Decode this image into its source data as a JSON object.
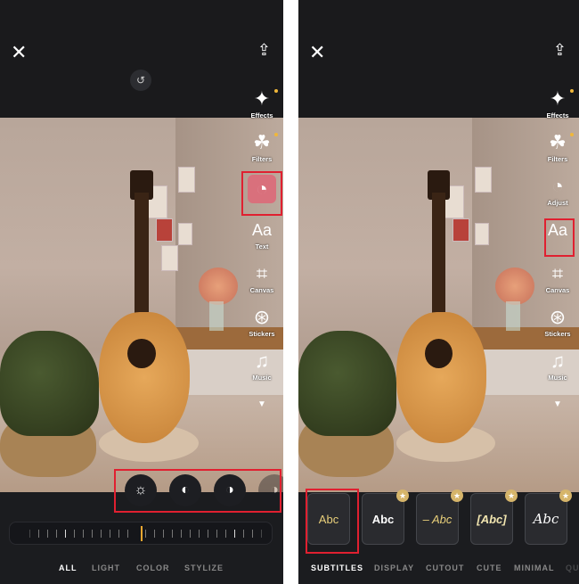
{
  "left_screen": {
    "close_icon": "close-icon",
    "share_icon": "share-icon",
    "history_icon": "history-icon",
    "tools": [
      {
        "label": "Effects",
        "icon": "sparkles-icon",
        "glyph": "✦",
        "new_dot": true
      },
      {
        "label": "Filters",
        "icon": "filters-icon",
        "glyph": "☘",
        "new_dot": true
      },
      {
        "label": "",
        "icon": "adjust-icon",
        "glyph": "◔",
        "selected": true
      },
      {
        "label": "Text",
        "icon": "text-icon",
        "glyph": "Aa"
      },
      {
        "label": "Canvas",
        "icon": "crop-icon",
        "glyph": "⌗"
      },
      {
        "label": "Stickers",
        "icon": "sticker-icon",
        "glyph": "⊛"
      },
      {
        "label": "Music",
        "icon": "music-icon",
        "glyph": "♫"
      },
      {
        "label": "",
        "icon": "more-down-icon",
        "glyph": "▼"
      }
    ],
    "adjust_tools": [
      {
        "icon": "brightness-icon",
        "glyph": "☼"
      },
      {
        "icon": "contrast-icon",
        "glyph": "◐"
      },
      {
        "icon": "exposure-icon",
        "glyph": "◑"
      },
      {
        "icon": "more-adjust-icon",
        "glyph": "◑"
      }
    ],
    "slider_value": 0,
    "categories": [
      "ALL",
      "LIGHT",
      "COLOR",
      "STYLIZE"
    ],
    "active_category": "ALL"
  },
  "right_screen": {
    "tools": [
      {
        "label": "Effects",
        "icon": "sparkles-icon",
        "glyph": "✦",
        "new_dot": true
      },
      {
        "label": "Filters",
        "icon": "filters-icon",
        "glyph": "☘",
        "new_dot": true
      },
      {
        "label": "Adjust",
        "icon": "adjust-icon",
        "glyph": "◔"
      },
      {
        "label": "",
        "icon": "text-icon",
        "glyph": "Aa",
        "selected": true
      },
      {
        "label": "Canvas",
        "icon": "crop-icon",
        "glyph": "⌗"
      },
      {
        "label": "Stickers",
        "icon": "sticker-icon",
        "glyph": "⊛"
      },
      {
        "label": "Music",
        "icon": "music-icon",
        "glyph": "♫"
      },
      {
        "label": "",
        "icon": "more-down-icon",
        "glyph": "▼"
      }
    ],
    "text_styles": [
      {
        "text": "Abc",
        "color": "#e8cf7a",
        "premium": false,
        "selected": true
      },
      {
        "text": "Abc",
        "color": "#ffffff",
        "premium": true
      },
      {
        "text": "– Abc",
        "color": "#e8cf7a",
        "premium": true
      },
      {
        "text": "[Abc]",
        "color": "#f2e6b0",
        "premium": true
      },
      {
        "text": "Abc",
        "color": "#ffffff",
        "premium": true
      }
    ],
    "categories": [
      "SUBTITLES",
      "DISPLAY",
      "CUTOUT",
      "CUTE",
      "MINIMAL",
      "QU"
    ],
    "active_category": "SUBTITLES"
  },
  "colors": {
    "accent": "#f0a830",
    "highlight": "#e02030",
    "selected_tool_bg": "#d9707c",
    "premium_star": "#d6b56a"
  }
}
